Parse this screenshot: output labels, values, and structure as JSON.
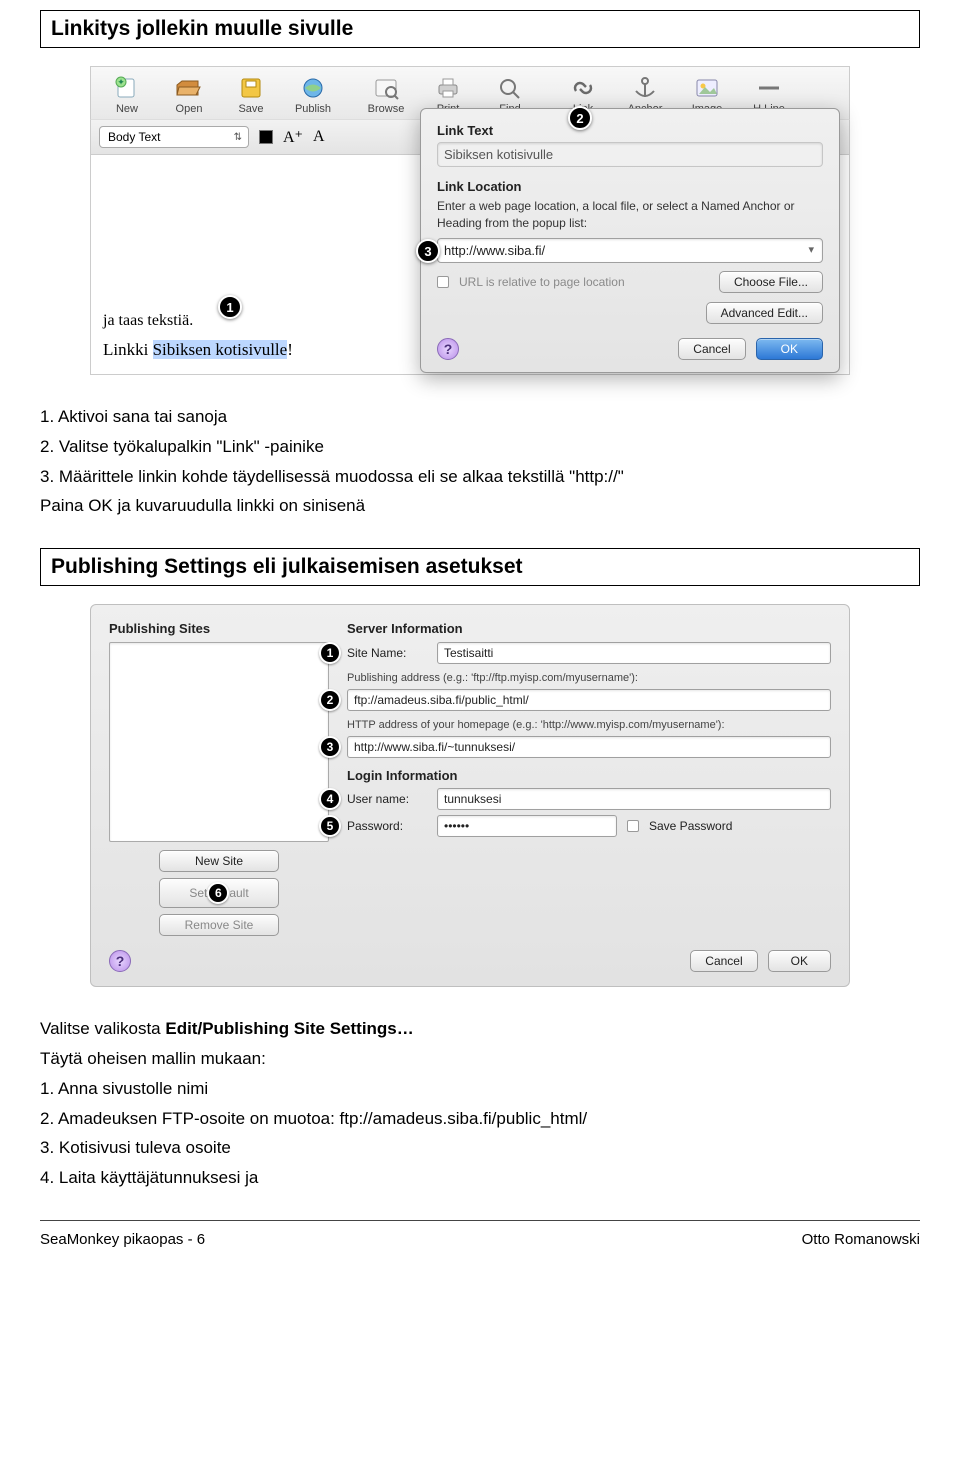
{
  "sections": {
    "s1_title": "Linkitys jollekin muulle sivulle",
    "s2_title": "Publishing Settings eli julkaisemisen asetukset"
  },
  "toolbar": {
    "items": [
      {
        "label": "New",
        "icon": "new"
      },
      {
        "label": "Open",
        "icon": "open"
      },
      {
        "label": "Save",
        "icon": "save"
      },
      {
        "label": "Publish",
        "icon": "publish"
      },
      {
        "label": "Browse",
        "icon": "browse"
      },
      {
        "label": "Print",
        "icon": "print"
      },
      {
        "label": "Find",
        "icon": "find"
      },
      {
        "label": "Link",
        "icon": "link"
      },
      {
        "label": "Anchor",
        "icon": "anchor"
      },
      {
        "label": "Image",
        "icon": "image"
      },
      {
        "label": "H.Line",
        "icon": "hline"
      }
    ],
    "format_dropdown": "Body Text",
    "font_increase": "A⁺",
    "font_decrease": "A"
  },
  "editor": {
    "line1": "ja taas tekstiä.",
    "line2_pre": "Linkki ",
    "line2_sel": "Sibiksen kotisivulle",
    "line2_post": "!"
  },
  "dialog": {
    "link_text_label": "Link Text",
    "link_text_value": "Sibiksen kotisivulle",
    "link_loc_label": "Link Location",
    "link_loc_help": "Enter a web page location, a local file, or select a Named Anchor or Heading from the popup list:",
    "url": "http://www.siba.fi/",
    "relative_label": "URL is relative to page location",
    "choose_file": "Choose File...",
    "adv_edit": "Advanced Edit...",
    "cancel": "Cancel",
    "ok": "OK"
  },
  "instr1": {
    "i1": "1. Aktivoi sana tai sanoja",
    "i2": "2. Valitse työkalupalkin \"Link\" -painike",
    "i3": "3. Määrittele linkin kohde täydellisessä muodossa eli se alkaa tekstillä \"http://\"",
    "i4": "Paina OK ja kuvaruudulla linkki on sinisenä"
  },
  "pub": {
    "left_title": "Publishing Sites",
    "new_site": "New Site",
    "set_default_pre": "Set ",
    "set_default_post": "ault",
    "remove_site": "Remove Site",
    "right_title": "Server Information",
    "site_name_label": "Site Name:",
    "site_name_value": "Testisaitti",
    "pub_addr_hint": "Publishing address (e.g.: 'ftp://ftp.myisp.com/myusername'):",
    "pub_addr_value": "ftp://amadeus.siba.fi/public_html/",
    "http_hint": "HTTP address of your homepage (e.g.: 'http://www.myisp.com/myusername'):",
    "http_value": "http://www.siba.fi/~tunnuksesi/",
    "login_title": "Login Information",
    "user_label": "User name:",
    "user_value": "tunnuksesi",
    "pass_label": "Password:",
    "pass_value": "••••••",
    "save_pass": "Save Password",
    "cancel": "Cancel",
    "ok": "OK"
  },
  "instr2": {
    "lead_a": "Valitse valikosta ",
    "lead_b": "Edit/Publishing Site Settings…",
    "sub": "Täytä oheisen mallin mukaan:",
    "i1": "1. Anna sivustolle nimi",
    "i2": "2. Amadeuksen FTP-osoite on muotoa: ftp://amadeus.siba.fi/public_html/",
    "i3": "3. Kotisivusi tuleva osoite",
    "i4": "4. Laita käyttäjätunnuksesi ja"
  },
  "footer": {
    "left": "SeaMonkey pikaopas - 6",
    "right": "Otto Romanowski"
  }
}
